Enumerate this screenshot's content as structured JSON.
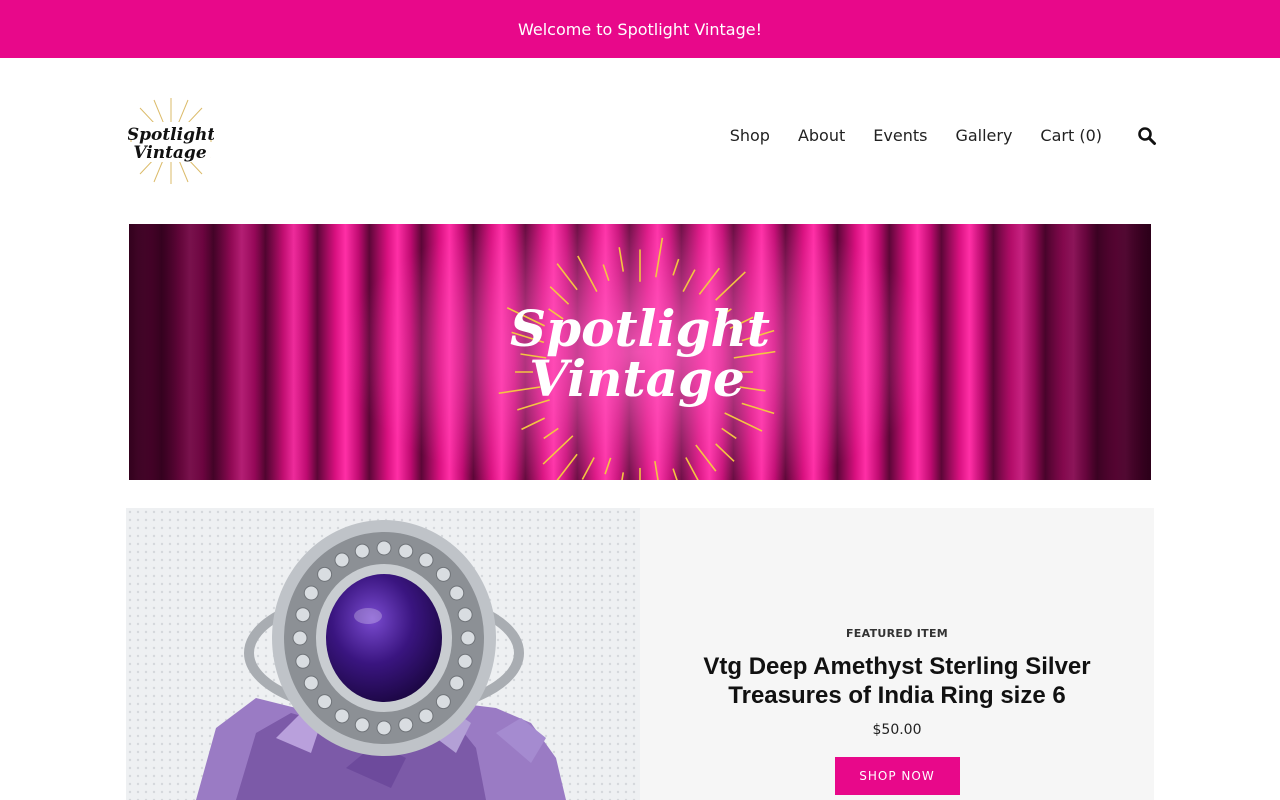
{
  "announcement": {
    "text": "Welcome to Spotlight Vintage!"
  },
  "logo": {
    "line1": "Spotlight",
    "line2": "Vintage"
  },
  "nav": {
    "items": [
      "Shop",
      "About",
      "Events",
      "Gallery"
    ],
    "cart_label": "Cart (0)",
    "search_icon": "search-icon"
  },
  "banner": {
    "line1": "Spotlight",
    "line2": "Vintage"
  },
  "featured": {
    "label": "FEATURED ITEM",
    "title": "Vtg Deep Amethyst Sterling Silver Treasures of India Ring size 6",
    "price": "$50.00",
    "button_label": "SHOP NOW"
  },
  "colors": {
    "accent": "#e8088a",
    "panel_bg": "#f6f6f6"
  }
}
